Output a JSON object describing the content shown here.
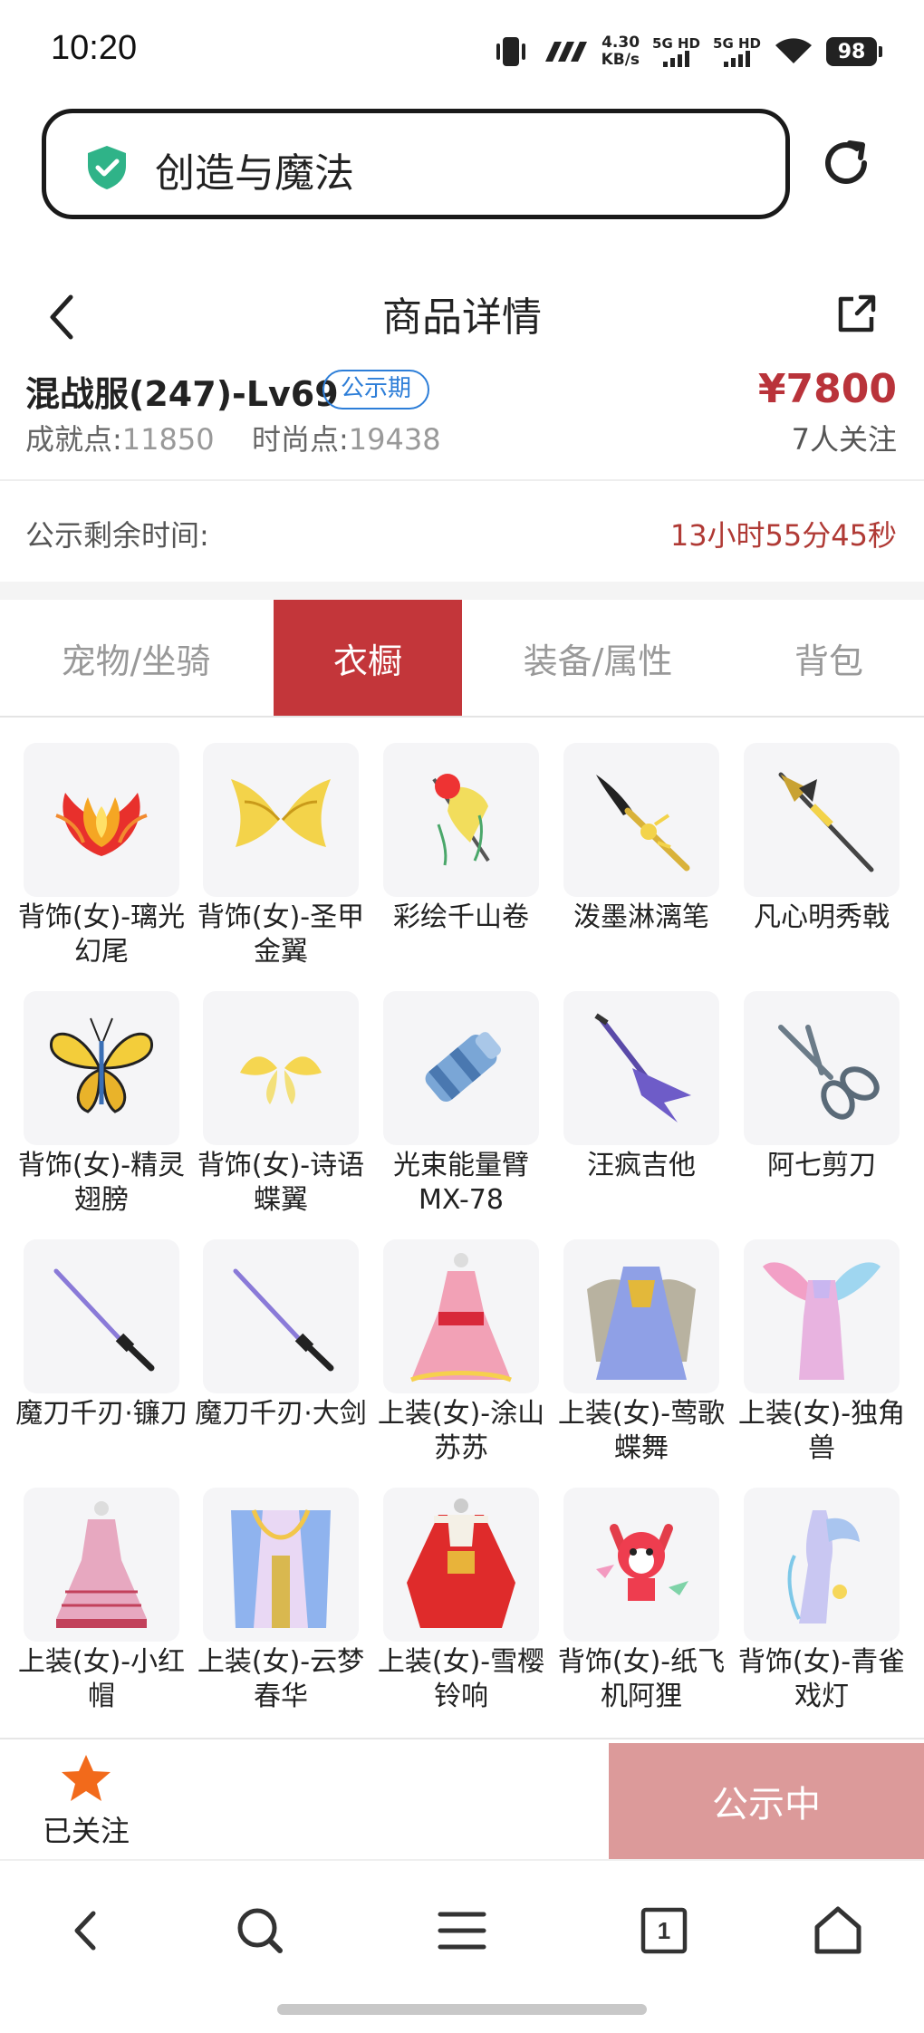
{
  "status_bar": {
    "time": "10:20",
    "speed_value": "4.30",
    "speed_unit": "KB/s",
    "sim1": "5G HD",
    "sim2": "5G HD",
    "battery": "98",
    "icons": [
      "vibrate-icon",
      "nfc-icon",
      "signal-icon",
      "wifi-icon",
      "battery-icon"
    ]
  },
  "address_bar": {
    "text": "创造与魔法",
    "icons": [
      "shield-check-icon",
      "reload-icon"
    ]
  },
  "header": {
    "title": "商品详情",
    "icons": [
      "back-icon",
      "share-icon"
    ]
  },
  "product": {
    "name": "混战服(247)-Lv69",
    "badge": "公示期",
    "price": "¥7800",
    "achievement_label": "成就点:",
    "achievement_value": "11850",
    "fashion_label": "时尚点:",
    "fashion_value": "19438",
    "followers": "7人关注"
  },
  "countdown": {
    "label": "公示剩余时间:",
    "value": "13小时55分45秒"
  },
  "tabs": [
    {
      "label": "宠物/坐骑",
      "active": false
    },
    {
      "label": "衣橱",
      "active": true
    },
    {
      "label": "装备/属性",
      "active": false
    },
    {
      "label": "背包",
      "active": false
    }
  ],
  "wardrobe_items": [
    {
      "label": "背饰(女)-璃光幻尾",
      "icon": "phoenix-tail-icon"
    },
    {
      "label": "背饰(女)-圣甲金翼",
      "icon": "gold-wings-icon"
    },
    {
      "label": "彩绘千山卷",
      "icon": "scroll-icon"
    },
    {
      "label": "泼墨淋漓笔",
      "icon": "brush-icon"
    },
    {
      "label": "凡心明秀戟",
      "icon": "halberd-icon"
    },
    {
      "label": "背饰(女)-精灵翅膀",
      "icon": "butterfly-wings-icon"
    },
    {
      "label": "背饰(女)-诗语蝶翼",
      "icon": "yellow-wings-icon"
    },
    {
      "label": "光束能量臂MX-78",
      "icon": "arm-cannon-icon"
    },
    {
      "label": "汪疯吉他",
      "icon": "guitar-icon"
    },
    {
      "label": "阿七剪刀",
      "icon": "scissors-icon"
    },
    {
      "label": "魔刀千刃·镰刀",
      "icon": "katana-icon"
    },
    {
      "label": "魔刀千刃·大剑",
      "icon": "katana-icon"
    },
    {
      "label": "上装(女)-涂山苏苏",
      "icon": "dress-icon"
    },
    {
      "label": "上装(女)-莺歌蝶舞",
      "icon": "armor-dress-icon"
    },
    {
      "label": "上装(女)-独角兽",
      "icon": "unicorn-dress-icon"
    },
    {
      "label": "上装(女)-小红帽",
      "icon": "dress-icon"
    },
    {
      "label": "上装(女)-云梦春华",
      "icon": "dress-icon"
    },
    {
      "label": "上装(女)-雪樱铃响",
      "icon": "dress-icon"
    },
    {
      "label": "背饰(女)-纸飞机阿狸",
      "icon": "fox-icon"
    },
    {
      "label": "背饰(女)-青雀戏灯",
      "icon": "lantern-icon"
    }
  ],
  "bottom_bar": {
    "follow_label": "已关注",
    "status_label": "公示中"
  },
  "browser_nav": {
    "tab_count": "1",
    "icons": [
      "back-icon",
      "search-icon",
      "menu-icon",
      "tabs-icon",
      "home-icon"
    ]
  },
  "colors": {
    "accent_red": "#c3363a",
    "price_red": "#b9333a",
    "badge_blue": "#2d7ed8",
    "status_button": "#dc9a9a",
    "shield_green": "#2fb388",
    "star_orange": "#f26a1b"
  }
}
